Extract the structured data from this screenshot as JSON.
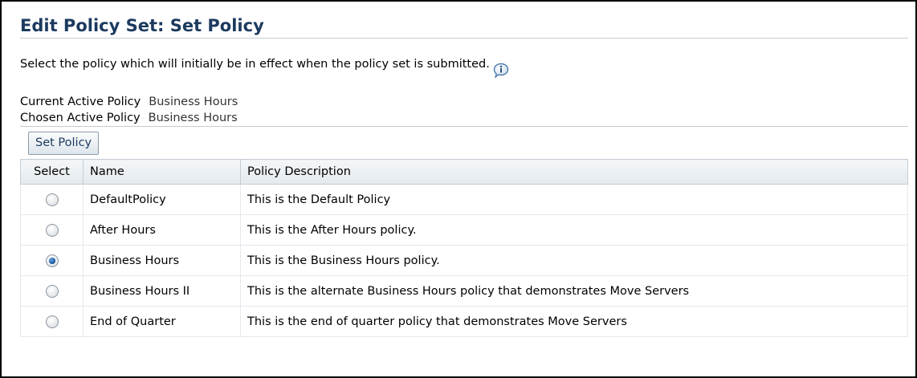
{
  "page": {
    "title": "Edit Policy Set: Set Policy",
    "instruction": "Select the policy which will initially be in effect when the policy set is submitted."
  },
  "summary": {
    "current_label": "Current Active Policy",
    "current_value": "Business Hours",
    "chosen_label": "Chosen Active Policy",
    "chosen_value": "Business Hours"
  },
  "toolbar": {
    "set_policy_label": "Set Policy"
  },
  "table": {
    "headers": {
      "select": "Select",
      "name": "Name",
      "description": "Policy Description"
    },
    "rows": [
      {
        "name": "DefaultPolicy",
        "description": "This is the Default Policy",
        "selected": false
      },
      {
        "name": "After Hours",
        "description": "This is the After Hours policy.",
        "selected": false
      },
      {
        "name": "Business Hours",
        "description": "This is the Business Hours policy.",
        "selected": true
      },
      {
        "name": "Business Hours II",
        "description": "This is the alternate Business Hours policy that demonstrates Move Servers",
        "selected": false
      },
      {
        "name": "End of Quarter",
        "description": "This is the end of quarter policy that demonstrates Move Servers",
        "selected": false
      }
    ]
  },
  "icons": {
    "info": "info-icon",
    "radio": "radio-button"
  },
  "colors": {
    "title": "#1c3a5e",
    "radio_selected": "#1f5fa8"
  }
}
